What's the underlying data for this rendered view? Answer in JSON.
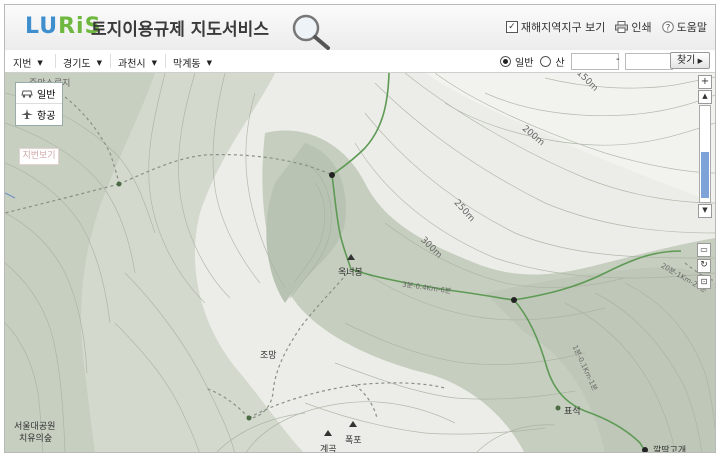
{
  "header": {
    "logo_part1": "LU",
    "logo_part2": "RiS",
    "title": "토지이용규제 지도서비스",
    "disaster_checkbox_label": "재해지역지구 보기",
    "disaster_checked": true,
    "print_label": "인쇄",
    "help_label": "도움말"
  },
  "toolbar": {
    "dropdowns": [
      {
        "label": "지번"
      },
      {
        "label": "경기도"
      },
      {
        "label": "과천시"
      },
      {
        "label": "막계동"
      }
    ],
    "radio_general": "일반",
    "radio_mountain": "산",
    "radio_selected": "일반",
    "lot_main_value": "",
    "lot_sub_value": "",
    "separator": "-",
    "find_label": "찾기"
  },
  "map_controls": {
    "type_general": "일반",
    "type_aerial": "항공",
    "jibeon_view": "지번보기",
    "zoom_in": "+",
    "zoom_out": "-",
    "zoom_level_fraction": 0.55
  },
  "map_labels": {
    "top_left_place": "중앙소류지",
    "contour_150": "150m",
    "contour_200": "200m",
    "contour_250": "250m",
    "contour_300": "300m",
    "peak": "옥녀봉",
    "trail_1": "3분-0.4Km-6분",
    "trail_2": "20분-1Km-28분",
    "trail_3": "1분-0.1Km-1분",
    "jomang": "조망",
    "park": "서울대공원",
    "park_sub": "치유의숲",
    "pyoseok": "표석",
    "gyegok": "계곡",
    "pokpo": "폭포",
    "pass": "깔딱고개"
  }
}
